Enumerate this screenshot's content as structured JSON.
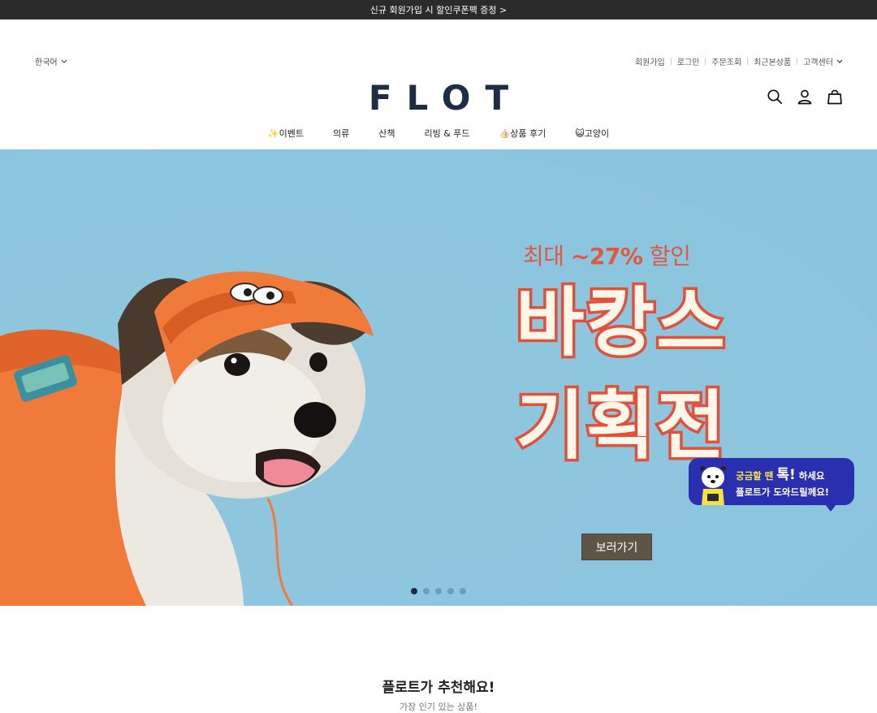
{
  "topbar": {
    "text": "신규 회원가입 시 할인쿠폰팩 증정 >"
  },
  "language": {
    "label": "한국어"
  },
  "util_links": [
    "회원가입",
    "로그인",
    "주문조회",
    "최근본상품",
    "고객센터"
  ],
  "brand": {
    "logo": "FLOT"
  },
  "icons": {
    "search": "search-icon",
    "account": "user-icon",
    "cart": "bag-icon"
  },
  "nav": {
    "items": [
      {
        "label": "✨이벤트"
      },
      {
        "label": "의류"
      },
      {
        "label": "산책"
      },
      {
        "label": "리빙 & 푸드"
      },
      {
        "label": "👍🏻상품 후기"
      },
      {
        "label": "😺고양이"
      }
    ]
  },
  "hero": {
    "sale_prefix": "최대",
    "sale_value": "~27%",
    "sale_suffix": "할인",
    "headline_line1": "바캉스",
    "headline_line2": "기획전",
    "cta_label": "보러가기",
    "slides_total": 5,
    "active_slide": 1,
    "colors": {
      "background": "#8ac4dd",
      "accent": "#e2503a",
      "cta": "#5d5647"
    }
  },
  "chat_widget": {
    "line1_a": "궁금할 땐",
    "line1_b": "톡!",
    "line1_c": "하세요",
    "line2": "플로트가 도와드릴께요!"
  },
  "recommend": {
    "title": "플로트가 추천해요!",
    "subtitle": "가장 인기 있는 상품!"
  }
}
